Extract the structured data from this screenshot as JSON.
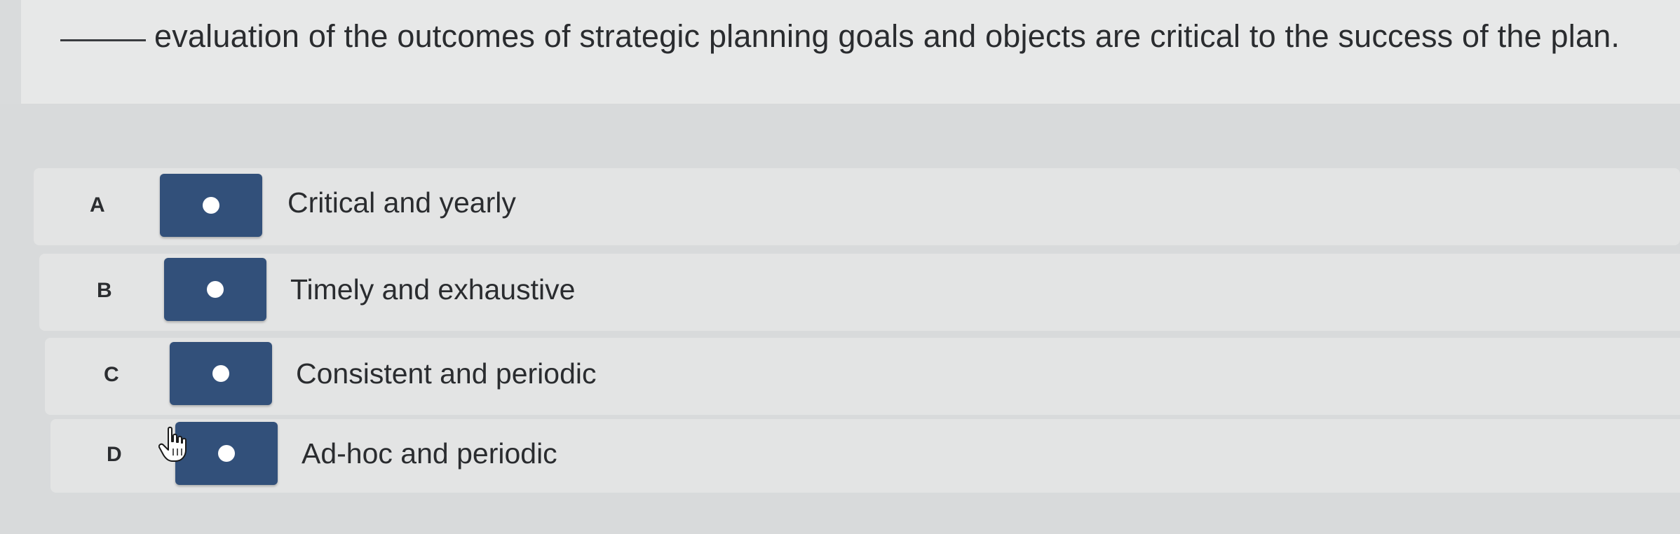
{
  "question": {
    "blank": "",
    "text": "evaluation of the outcomes of strategic planning goals and objects are critical to the success of the plan."
  },
  "options": [
    {
      "letter": "A",
      "label": "Critical and yearly"
    },
    {
      "letter": "B",
      "label": "Timely and exhaustive"
    },
    {
      "letter": "C",
      "label": "Consistent and periodic"
    },
    {
      "letter": "D",
      "label": "Ad-hoc and periodic"
    }
  ],
  "colors": {
    "toggle": "#32507a",
    "page_background": "#d9dbdc",
    "row_background": "#e3e4e4",
    "text": "#2a2c2f"
  },
  "icons": {
    "cursor": "hand-pointer-icon",
    "toggle_indicator": "radio-dot-icon"
  }
}
